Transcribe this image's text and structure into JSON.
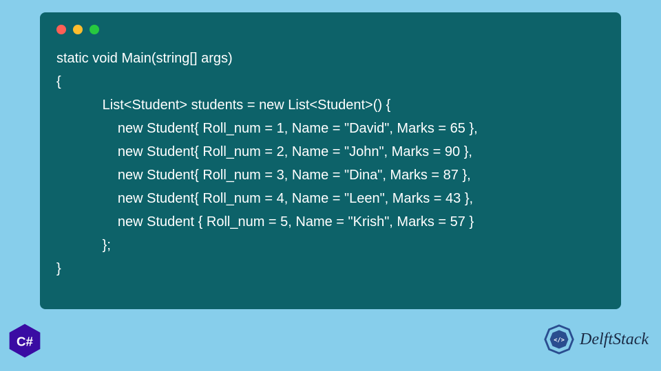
{
  "code": {
    "lines": [
      "static void Main(string[] args)",
      "{",
      "            List<Student> students = new List<Student>() {",
      "                new Student{ Roll_num = 1, Name = \"David\", Marks = 65 },",
      "                new Student{ Roll_num = 2, Name = \"John\", Marks = 90 },",
      "                new Student{ Roll_num = 3, Name = \"Dina\", Marks = 87 },",
      "                new Student{ Roll_num = 4, Name = \"Leen\", Marks = 43 },",
      "                new Student { Roll_num = 5, Name = \"Krish\", Marks = 57 }",
      "            };",
      "}"
    ]
  },
  "badge": {
    "language": "C#"
  },
  "brand": {
    "name": "DelftStack"
  },
  "colors": {
    "pageBg": "#87ceeb",
    "codeBg": "#0d6269",
    "codeText": "#ffffff",
    "dotRed": "#ff5f56",
    "dotYellow": "#ffbd2e",
    "dotGreen": "#27c93f",
    "badgeBg": "#3a0ca3",
    "brandText": "#1a2a44"
  }
}
